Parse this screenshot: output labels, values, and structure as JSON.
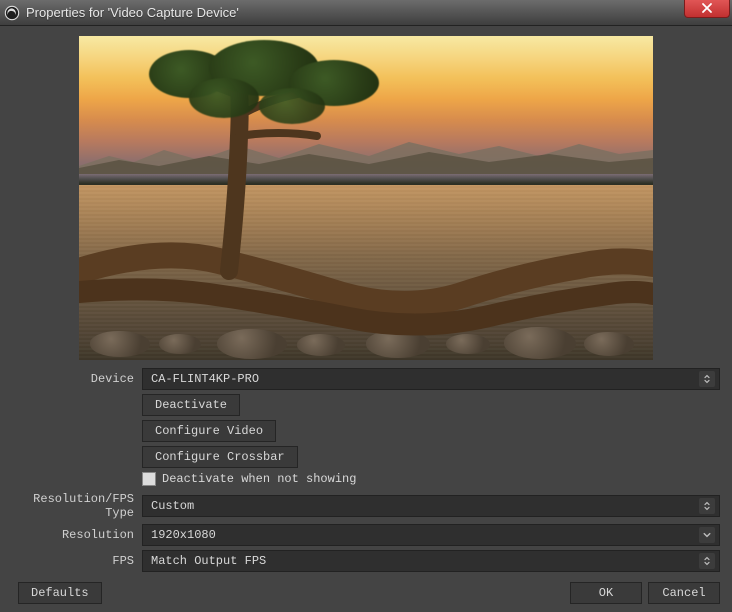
{
  "titlebar": {
    "title": "Properties for 'Video Capture Device'"
  },
  "form": {
    "device_label": "Device",
    "device_value": "CA-FLINT4KP-PRO",
    "deactivate_btn": "Deactivate",
    "configure_video_btn": "Configure Video",
    "configure_crossbar_btn": "Configure Crossbar",
    "deactivate_when_not_showing": "Deactivate when not showing",
    "resfps_type_label": "Resolution/FPS Type",
    "resfps_type_value": "Custom",
    "resolution_label": "Resolution",
    "resolution_value": "1920x1080",
    "fps_label": "FPS",
    "fps_value": "Match Output FPS"
  },
  "footer": {
    "defaults": "Defaults",
    "ok": "OK",
    "cancel": "Cancel"
  }
}
